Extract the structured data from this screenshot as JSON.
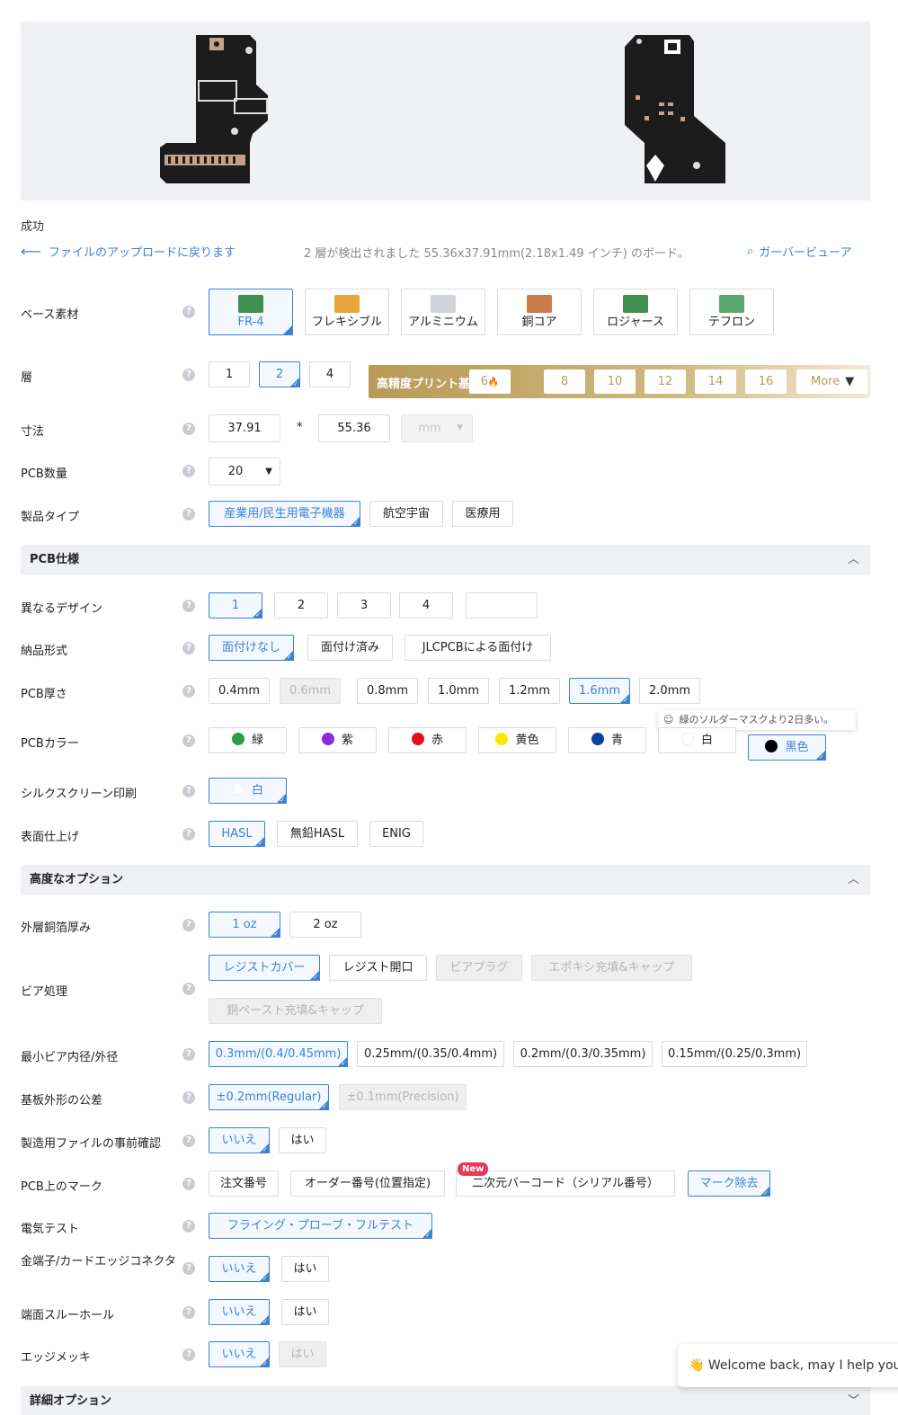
{
  "header": {
    "status": "成功",
    "back_link": "ファイルのアップロードに戻ります",
    "detected": "2 層が検出されました 55.36x37.91mm(2.18x1.49 インチ) のボード。",
    "gerber_viewer": "ガーバービューア"
  },
  "rows": {
    "base_material": "ベース素材",
    "layers": "層",
    "dimensions": "寸法",
    "pcb_qty": "PCB数量",
    "product_type": "製品タイプ",
    "different_design": "異なるデザイン",
    "delivery_format": "納品形式",
    "pcb_thickness": "PCB厚さ",
    "pcb_color": "PCBカラー",
    "silkscreen": "シルクスクリーン印刷",
    "surface_finish": "表面仕上げ",
    "outer_copper": "外層銅箔厚み",
    "via_covering": "ビア処理",
    "min_via": "最小ビア内径/外径",
    "board_tolerance": "基板外形の公差",
    "confirm_production": "製造用ファイルの事前確認",
    "mark_on_pcb": "PCB上のマーク",
    "electrical_test": "電気テスト",
    "gold_fingers": "金端子/カードエッジコネクタ",
    "castellated": "端面スルーホール",
    "edge_plating": "エッジメッキ"
  },
  "help_icon": "?",
  "materials": [
    {
      "label": "FR-4",
      "selected": true,
      "color": "#3f8f4e"
    },
    {
      "label": "フレキシブル",
      "selected": false,
      "color": "#e8a33a"
    },
    {
      "label": "アルミニウム",
      "selected": false,
      "color": "#cfd3d8"
    },
    {
      "label": "銅コア",
      "selected": false,
      "color": "#c97b4a"
    },
    {
      "label": "ロジャース",
      "selected": false,
      "color": "#3f8f4e"
    },
    {
      "label": "テフロン",
      "selected": false,
      "color": "#5aa86a"
    }
  ],
  "layers": {
    "options": [
      "1",
      "2",
      "4"
    ],
    "hp_title": "高精度プリント基板",
    "hp_options": [
      "6",
      "8",
      "10",
      "12",
      "14",
      "16"
    ],
    "hp_fire": "🔥",
    "more": "More"
  },
  "dims": {
    "width": "37.91",
    "sep": "*",
    "height": "55.36",
    "unit": "mm"
  },
  "qty": {
    "value": "20"
  },
  "product_types": [
    "産業用/民生用電子機器",
    "航空宇宙",
    "医療用"
  ],
  "sections": {
    "pcb_spec": "PCB仕様",
    "advanced": "高度なオプション",
    "detail": "詳細オプション"
  },
  "designs": [
    "1",
    "2",
    "3",
    "4",
    ""
  ],
  "delivery": [
    "面付けなし",
    "面付け済み",
    "JLCPCBによる面付け"
  ],
  "thickness": [
    "0.4mm",
    "0.6mm",
    "0.8mm",
    "1.0mm",
    "1.2mm",
    "1.6mm",
    "2.0mm"
  ],
  "tooltip": "緑のソルダーマスクより2日多い。",
  "colors": [
    {
      "label": "緑",
      "hex": "#27a046"
    },
    {
      "label": "紫",
      "hex": "#8a2be2"
    },
    {
      "label": "赤",
      "hex": "#e3101b"
    },
    {
      "label": "黄色",
      "hex": "#ffe600"
    },
    {
      "label": "青",
      "hex": "#0a3f9c"
    },
    {
      "label": "白",
      "hex": "#ffffff"
    },
    {
      "label": "黒色",
      "hex": "#000000"
    }
  ],
  "silk": {
    "label": "白"
  },
  "finish": [
    "HASL",
    "無鉛HASL",
    "ENIG"
  ],
  "copper": [
    "1 oz",
    "2 oz"
  ],
  "via": [
    "レジストカバー",
    "レジスト開口",
    "ビアプラグ",
    "エポキシ充填&キャップ",
    "銅ペースト充填&キャップ"
  ],
  "min_via": [
    "0.3mm/(0.4/0.45mm)",
    "0.25mm/(0.35/0.4mm)",
    "0.2mm/(0.3/0.35mm)",
    "0.15mm/(0.25/0.3mm)"
  ],
  "tolerance": [
    "±0.2mm(Regular)",
    "±0.1mm(Precision)"
  ],
  "yes_no": {
    "no": "いいえ",
    "yes": "はい"
  },
  "marks": [
    "注文番号",
    "オーダー番号(位置指定)",
    "二次元バーコード（シリアル番号）",
    "マーク除去"
  ],
  "new_tag": "New",
  "etest": "フライング・プローブ・フルテスト",
  "chat": "👋 Welcome back, may I help you?"
}
